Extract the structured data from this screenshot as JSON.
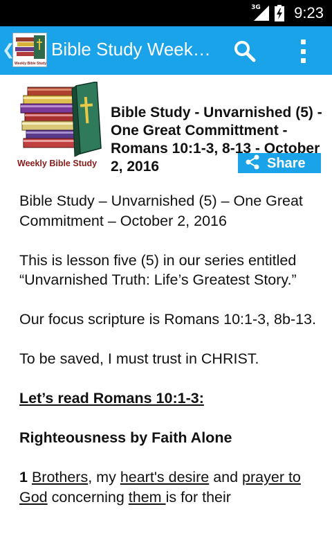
{
  "status_bar": {
    "network": "3G",
    "time": "9:23"
  },
  "app_bar": {
    "title": "Bible Study Week…",
    "logo_caption": "Weekly Bible Study",
    "icons": [
      "back-chevron-icon",
      "search-icon",
      "overflow-menu-icon"
    ]
  },
  "header": {
    "image_caption": "Weekly Bible Study",
    "title": "Bible Study - Unvarnished (5) - One Great Committment - Romans 10:1-3, 8-13 - October 2, 2016",
    "share_label": "Share"
  },
  "body": {
    "p1": "Bible Study – Unvarnished (5) – One Great Commitment – October 2, 2016",
    "p2": "This is lesson five (5) in our series entitled “Unvarnished Truth: Life’s Greatest Story.”",
    "p3": "Our focus scripture is Romans 10:1-3, 8b-13.",
    "p4": "To be saved, I must trust in CHRIST.",
    "heading_read": "Let’s read Romans 10:1-3:",
    "heading_section": "Righteousness by Faith Alone",
    "verse": {
      "number": "1",
      "w1": "Brothers",
      "t1": ", my ",
      "w2": "heart's desire",
      "t2": " and ",
      "w3": "prayer to God",
      "t3": " concerning ",
      "w4": "them ",
      "t4": "is for their"
    }
  },
  "colors": {
    "accent": "#1aa3e8",
    "status_bar": "#000000",
    "caption_red": "#8b1a1a"
  }
}
